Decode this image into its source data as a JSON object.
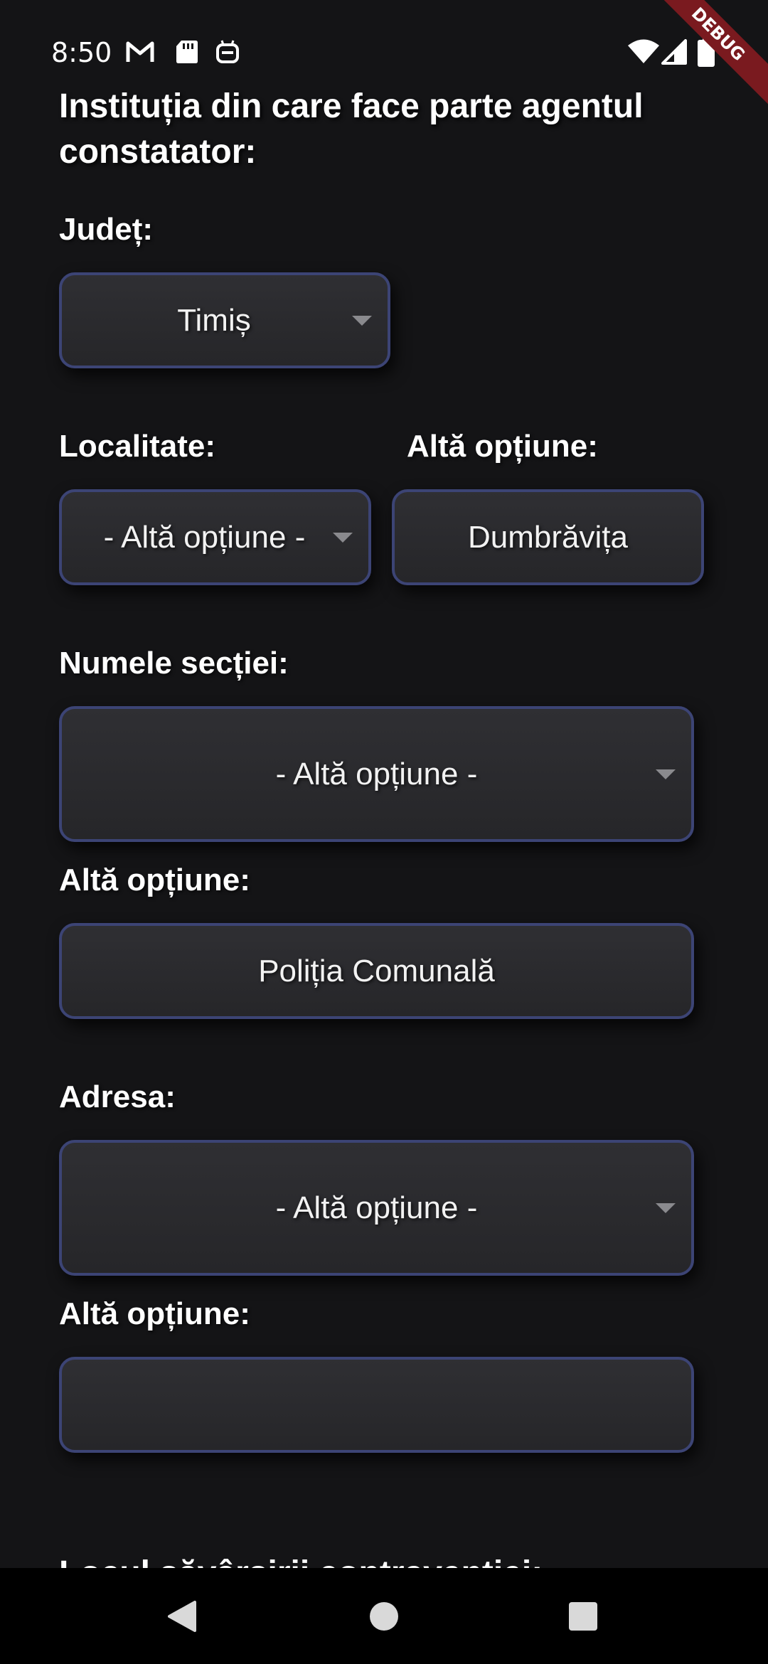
{
  "status_bar": {
    "time": "8:50",
    "icons": [
      "gmail-icon",
      "sd-card-icon",
      "robot-face-icon",
      "wifi-icon",
      "cell-signal-icon",
      "battery-icon"
    ],
    "debug_banner": "DEBUG"
  },
  "form": {
    "section_title": "Instituția din care face parte agentul constatator:",
    "judet": {
      "label": "Județ:",
      "value": "Timiș"
    },
    "localitate": {
      "label": "Localitate:",
      "value": "- Altă opțiune -"
    },
    "localitate_alt": {
      "label": "Altă opțiune:",
      "value": "Dumbrăvița"
    },
    "sectie": {
      "label": "Numele secției:",
      "value": "- Altă opțiune -"
    },
    "sectie_alt": {
      "label": "Altă opțiune:",
      "value": "Poliția Comunală"
    },
    "adresa": {
      "label": "Adresa:",
      "value": "- Altă opțiune -"
    },
    "adresa_alt": {
      "label": "Altă opțiune:",
      "value": ""
    },
    "next_section_title": "Locul săvârșirii contravenției:"
  },
  "nav_bar": {
    "buttons": [
      "back-icon",
      "home-icon",
      "recents-icon"
    ]
  },
  "colors": {
    "background": "#141416",
    "field_border": "#3c4475",
    "field_fill": "#2c2c30",
    "debug_ribbon": "#7a1a1f"
  }
}
